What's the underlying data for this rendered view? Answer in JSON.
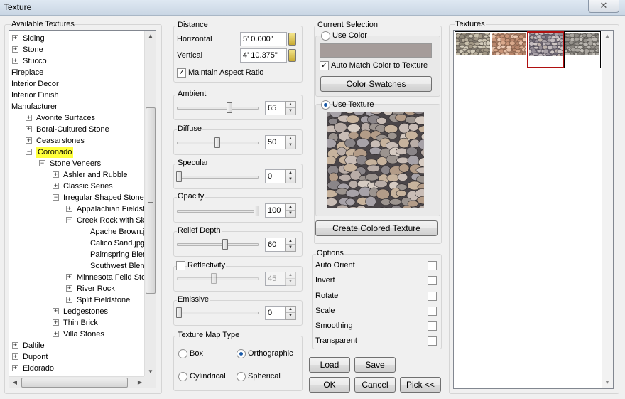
{
  "window": {
    "title": "Texture",
    "close_glyph": "✕"
  },
  "available": {
    "label": "Available Textures",
    "items": [
      {
        "label": "Siding",
        "indent": 0,
        "exp": "+"
      },
      {
        "label": "Stone",
        "indent": 0,
        "exp": "+"
      },
      {
        "label": "Stucco",
        "indent": 0,
        "exp": "+"
      },
      {
        "label": "Fireplace",
        "indent": 0,
        "exp": ""
      },
      {
        "label": "Interior Decor",
        "indent": 0,
        "exp": ""
      },
      {
        "label": "Interior Finish",
        "indent": 0,
        "exp": ""
      },
      {
        "label": "Manufacturer",
        "indent": 0,
        "exp": ""
      },
      {
        "label": "Avonite Surfaces",
        "indent": 1,
        "exp": "+"
      },
      {
        "label": "Boral-Cultured Stone",
        "indent": 1,
        "exp": "+"
      },
      {
        "label": "Ceasarstones",
        "indent": 1,
        "exp": "+"
      },
      {
        "label": "Coronado",
        "indent": 1,
        "exp": "-",
        "selected": true
      },
      {
        "label": "Stone Veneers",
        "indent": 2,
        "exp": "-"
      },
      {
        "label": "Ashler and Rubble",
        "indent": 3,
        "exp": "+"
      },
      {
        "label": "Classic Series",
        "indent": 3,
        "exp": "+"
      },
      {
        "label": "Irregular Shaped Stones",
        "indent": 3,
        "exp": "-"
      },
      {
        "label": "Appalachian Fieldstone",
        "indent": 4,
        "exp": "+"
      },
      {
        "label": "Creek Rock with Skippe",
        "indent": 4,
        "exp": "-"
      },
      {
        "label": "Apache Brown.jpg",
        "indent": 5,
        "exp": ""
      },
      {
        "label": "Calico Sand.jpg",
        "indent": 5,
        "exp": ""
      },
      {
        "label": "Palmspring Blend.jpg",
        "indent": 5,
        "exp": ""
      },
      {
        "label": "Southwest Blend.jpg",
        "indent": 5,
        "exp": ""
      },
      {
        "label": "Minnesota Feild Stone",
        "indent": 4,
        "exp": "+"
      },
      {
        "label": "River Rock",
        "indent": 4,
        "exp": "+"
      },
      {
        "label": "Split Fieldstone",
        "indent": 4,
        "exp": "+"
      },
      {
        "label": "Ledgestones",
        "indent": 3,
        "exp": "+"
      },
      {
        "label": "Thin Brick",
        "indent": 3,
        "exp": "+"
      },
      {
        "label": "Villa Stones",
        "indent": 3,
        "exp": "+"
      },
      {
        "label": "Daltile",
        "indent": 0,
        "exp": "+"
      },
      {
        "label": "Dupont",
        "indent": 0,
        "exp": "+"
      },
      {
        "label": "Eldorado",
        "indent": 0,
        "exp": "+"
      }
    ]
  },
  "distance": {
    "label": "Distance",
    "horizontal_label": "Horizontal",
    "horizontal_value": "5' 0.000\"",
    "vertical_label": "Vertical",
    "vertical_value": "4' 10.375\"",
    "maintain_label": "Maintain Aspect Ratio",
    "maintain_checked": "✓"
  },
  "ambient": {
    "label": "Ambient",
    "value": "65"
  },
  "diffuse": {
    "label": "Diffuse",
    "value": "50"
  },
  "specular": {
    "label": "Specular",
    "value": "0"
  },
  "opacity": {
    "label": "Opacity",
    "value": "100"
  },
  "relief": {
    "label": "Relief Depth",
    "value": "60"
  },
  "reflectivity": {
    "label": "Reflectivity",
    "value": "45"
  },
  "emissive": {
    "label": "Emissive",
    "value": "0"
  },
  "maptype": {
    "label": "Texture Map Type",
    "box": "Box",
    "orthographic": "Orthographic",
    "cylindrical": "Cylindrical",
    "spherical": "Spherical"
  },
  "selection": {
    "label": "Current Selection",
    "use_color": "Use Color",
    "swatch_color": "#a59c9a",
    "auto_match": "Auto Match Color to Texture",
    "auto_match_checked": "✓",
    "color_swatches": "Color Swatches",
    "use_texture": "Use Texture",
    "create_colored": "Create Colored Texture"
  },
  "options": {
    "label": "Options",
    "items": [
      "Auto Orient",
      "Invert",
      "Rotate",
      "Scale",
      "Smoothing",
      "Transparent"
    ]
  },
  "buttons": {
    "load": "Load",
    "save": "Save",
    "ok": "OK",
    "cancel": "Cancel",
    "pick": "Pick <<"
  },
  "textures": {
    "label": "Textures"
  }
}
